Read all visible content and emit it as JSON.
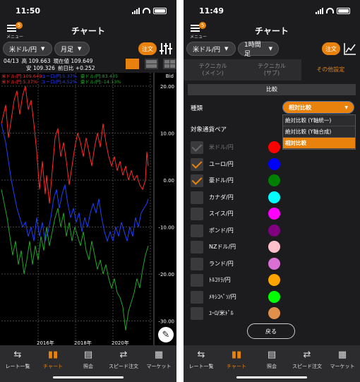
{
  "left": {
    "status_time": "11:50",
    "menu_badge": "5",
    "menu_label": "メニュー",
    "title": "チャート",
    "pair_select": "米ドル/円",
    "period_select": "月足",
    "order_label": "注文",
    "info": {
      "date": "04/13",
      "high": "高 109.663",
      "low": "安 109.326",
      "current": "現在値 109.649",
      "change": "前日比 +0.252"
    },
    "legend_row1": [
      "米ドル/円:109.649",
      "ユーロ/円:5.37%",
      "豪ドル/円:83.435"
    ],
    "legend_row2": [
      "米ドル/円:5.37%",
      "ユーロ/円:4.52%",
      "豪ドル/円:-14.13%"
    ],
    "bid_label": "Bid",
    "y_ticks": [
      "20.00",
      "10.00",
      "0.00",
      "-10.00",
      "-20.00",
      "-30.00"
    ],
    "x_ticks": [
      "2016年",
      "2018年",
      "2020年"
    ],
    "colors": {
      "red": "#ff2a2a",
      "blue": "#2040ff",
      "green": "#1fa82a",
      "accent": "#e8820c"
    }
  },
  "right": {
    "status_time": "11:49",
    "menu_badge": "5",
    "menu_label": "メニュー",
    "title": "チャート",
    "pair_select": "米ドル/円",
    "period_select": "1時間足",
    "order_label": "注文",
    "subtabs": [
      "テクニカル\n(メイン)",
      "テクニカル\n(サブ)",
      "その他設定"
    ],
    "section_title": "比較",
    "type_label": "種類",
    "type_value": "相対比較",
    "type_options": [
      "絶対比較 (Y軸統一)",
      "絶対比較 (Y軸合成)",
      "相対比較"
    ],
    "pairs_label": "対象通貨ペア",
    "pairs": [
      {
        "name": "米ドル/円",
        "state": "disabled",
        "color": "#ff0000"
      },
      {
        "name": "ユーロ/円",
        "state": "checked",
        "color": "#0000ff"
      },
      {
        "name": "豪ドル/円",
        "state": "checked",
        "color": "#008000"
      },
      {
        "name": "カナダ/円",
        "state": "unchecked",
        "color": "#00ffff"
      },
      {
        "name": "スイス/円",
        "state": "unchecked",
        "color": "#ff00ff"
      },
      {
        "name": "ポンド/円",
        "state": "unchecked",
        "color": "#800080"
      },
      {
        "name": "NZドル/円",
        "state": "unchecked",
        "color": "#ffc0cb"
      },
      {
        "name": "ランド/円",
        "state": "unchecked",
        "color": "#da70d6"
      },
      {
        "name": "ﾄﾙｺﾘﾗ/円",
        "state": "unchecked",
        "color": "#ffa500"
      },
      {
        "name": "ﾒｷｼｺﾍﾟｿ/円",
        "state": "unchecked",
        "color": "#00ff00"
      },
      {
        "name": "ﾕｰﾛ/米ﾄﾞﾙ",
        "state": "unchecked",
        "color": "#e0904a"
      }
    ],
    "back_label": "戻る"
  },
  "tabbar": [
    {
      "label": "レート一覧",
      "icon": "rate-list-icon",
      "glyph": "⇆"
    },
    {
      "label": "チャート",
      "icon": "chart-icon",
      "glyph": "▮▮"
    },
    {
      "label": "照会",
      "icon": "inquiry-icon",
      "glyph": "▤"
    },
    {
      "label": "スピード注文",
      "icon": "speed-order-icon",
      "glyph": "⇄"
    },
    {
      "label": "マーケット",
      "icon": "market-icon",
      "glyph": "▦"
    }
  ]
}
